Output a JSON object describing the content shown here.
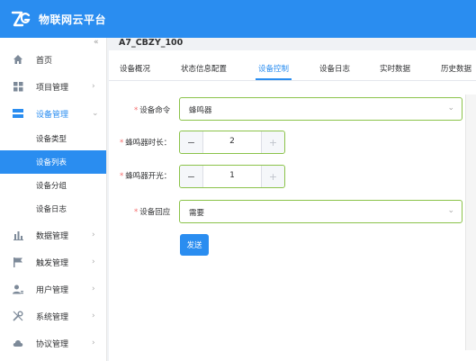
{
  "app": {
    "title": "物联网云平台"
  },
  "sidebar": {
    "collapse_icon": "«",
    "items": [
      {
        "label": "首页",
        "icon": "home-icon"
      },
      {
        "label": "项目管理",
        "icon": "grid-icon"
      },
      {
        "label": "设备管理",
        "icon": "device-icon",
        "expanded": true
      },
      {
        "label": "数据管理",
        "icon": "bar-chart-icon"
      },
      {
        "label": "触发管理",
        "icon": "flag-icon"
      },
      {
        "label": "用户管理",
        "icon": "user-icon"
      },
      {
        "label": "系统管理",
        "icon": "tools-icon"
      },
      {
        "label": "协议管理",
        "icon": "cloud-icon"
      }
    ],
    "sub_items": [
      {
        "label": "设备类型"
      },
      {
        "label": "设备列表",
        "selected": true
      },
      {
        "label": "设备分组"
      },
      {
        "label": "设备日志"
      }
    ]
  },
  "breadcrumb": "A7_CBZY_100",
  "tabs": [
    {
      "label": "设备概况"
    },
    {
      "label": "状态信息配置"
    },
    {
      "label": "设备控制",
      "active": true
    },
    {
      "label": "设备日志"
    },
    {
      "label": "实时数据"
    },
    {
      "label": "历史数据"
    }
  ],
  "form": {
    "command": {
      "label": "设备命令",
      "value": "蜂鸣器"
    },
    "duration": {
      "label": "蜂鸣器时长：",
      "value": "2"
    },
    "switch": {
      "label": "蜂鸣器开光：",
      "value": "1"
    },
    "reply": {
      "label": "设备回应",
      "value": "需要"
    },
    "send_label": "发送",
    "required_mark": "*"
  },
  "colors": {
    "accent": "#2a8df0",
    "valid_border": "#8bc34a",
    "required": "#f56c6c"
  }
}
